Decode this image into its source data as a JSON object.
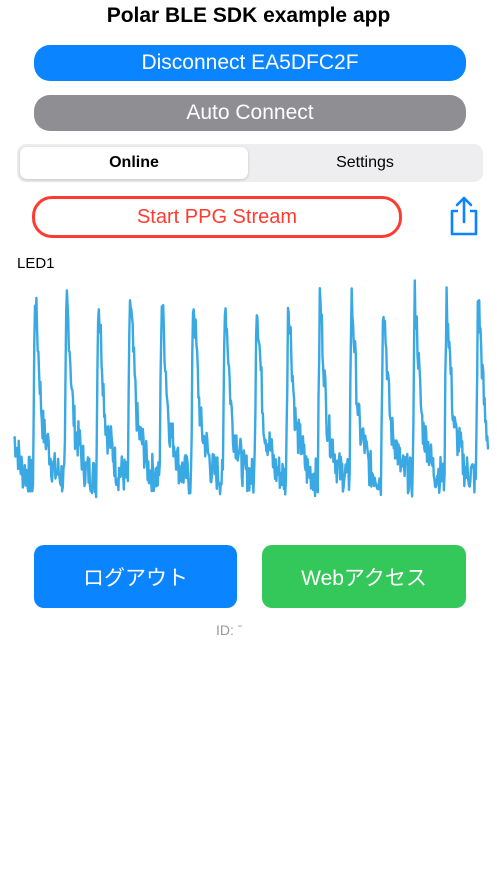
{
  "header": {
    "title": "Polar BLE SDK example app"
  },
  "buttons": {
    "disconnect_label": "Disconnect EA5DFC2F",
    "auto_connect_label": "Auto Connect",
    "ppg_stream_label": "Start PPG Stream",
    "logout_label": "ログアウト",
    "web_access_label": "Webアクセス"
  },
  "tabs": [
    {
      "label": "Online",
      "selected": true
    },
    {
      "label": "Settings",
      "selected": false
    }
  ],
  "chart_data": {
    "type": "line",
    "series": [
      {
        "name": "LED1",
        "color": "#3aa8e3"
      }
    ],
    "title": "",
    "xlabel": "",
    "ylabel": "",
    "grid": false
  },
  "footer": {
    "id_text": "ID: ˉ"
  },
  "colors": {
    "primary": "#0a84ff",
    "secondary": "#8e8e93",
    "danger": "#ff3b30",
    "success": "#34c759",
    "series": "#3aa8e3"
  },
  "icons": {
    "share": "share-icon"
  }
}
